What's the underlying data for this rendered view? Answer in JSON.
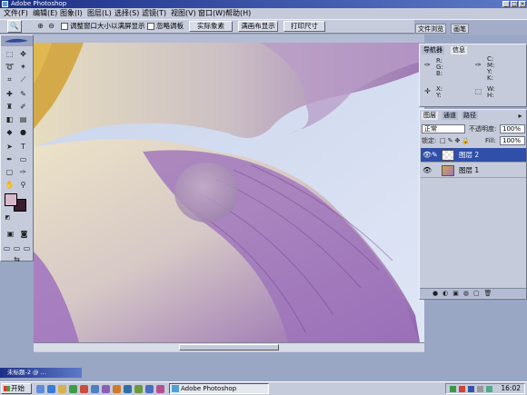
{
  "titlebar": {
    "title": "Adobe Photoshop"
  },
  "menu": [
    "文件(F)",
    "编辑(E)",
    "图象(I)",
    "图层(L)",
    "选择(S)",
    "滤镜(T)",
    "视图(V)",
    "窗口(W)",
    "帮助(H)"
  ],
  "options": {
    "resize_label": "调整窗口大小以满屏显示",
    "ignore_label": "忽略调板",
    "actual_pixels": "实际象素",
    "fit_screen": "满画布显示",
    "print_size": "打印尺寸"
  },
  "palette_well": {
    "tab1": "文件浏览",
    "tab2": "画笔"
  },
  "navigator": {
    "tab_nav": "导航器",
    "tab_info": "信息",
    "rgb": [
      "R:",
      "G:",
      "B:"
    ],
    "cmyk": [
      "C:",
      "M:",
      "Y:",
      "K:"
    ],
    "xy": [
      "X:",
      "Y:"
    ],
    "wh": [
      "W:",
      "H:"
    ]
  },
  "layers": {
    "tab_layers": "图层",
    "tab_channels": "通道",
    "tab_paths": "路径",
    "blend_mode": "正常",
    "opacity_label": "不透明度:",
    "opacity_value": "100%",
    "lock_label": "锁定:",
    "fill_label": "Fill:",
    "fill_value": "100%",
    "items": [
      {
        "name": "图层 2",
        "selected": true
      },
      {
        "name": "图层 1",
        "selected": false
      }
    ]
  },
  "minimized_doc": {
    "title": "未标题-2 @ ..."
  },
  "taskbar": {
    "start": "开始",
    "app": "Adobe Photoshop",
    "clock": "16:02"
  },
  "colors": {
    "titlebar_start": "#1b2f86",
    "panel_bg": "#c6cbdb",
    "selected_layer": "#2f4fa8",
    "foreground_swatch": "#d9b9c9",
    "background_swatch": "#3a1c30"
  }
}
